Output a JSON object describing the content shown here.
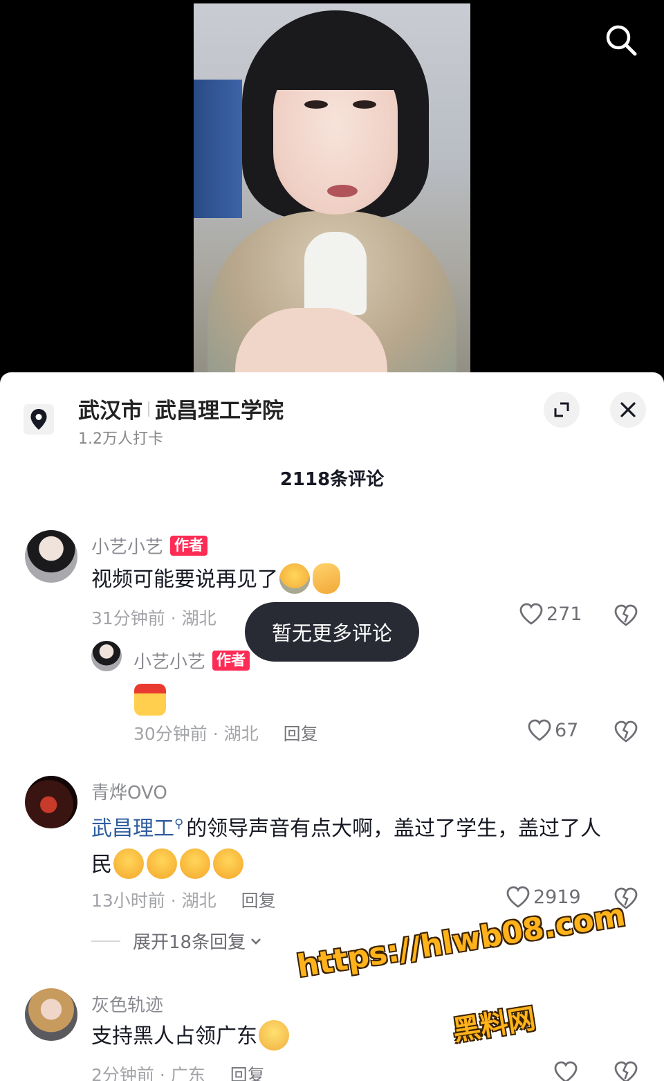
{
  "icons": {
    "search": "search-icon",
    "location": "location-pin-icon",
    "expand": "expand-icon",
    "close": "close-icon",
    "like": "heart-outline-icon",
    "dislike": "broken-heart-icon",
    "chevron": "chevron-down-icon"
  },
  "colors": {
    "author_tag": "#fe2c55",
    "topic_link": "#2f5d9f",
    "watermark": "#ffb21a"
  },
  "location": {
    "city": "武汉市",
    "place": "武昌理工学院",
    "checkins": "1.2万人打卡"
  },
  "comments_header": {
    "title": "2118条评论"
  },
  "comments": [
    {
      "user": "小艺小艺",
      "tag": "作者",
      "text": "视频可能要说再见了",
      "emojis": [
        "cry",
        "wave"
      ],
      "meta": "31分钟前 · 湖北",
      "likes": "271",
      "replies": [
        {
          "user": "小艺小艺",
          "tag": "作者",
          "meta": "30分钟前 · 湖北",
          "reply_label": "回复",
          "likes": "67"
        }
      ]
    },
    {
      "user": "青烨OVO",
      "topic": "武昌理工",
      "text": "的领导声音有点大啊，盖过了学生，盖过了人",
      "text_line2": "民",
      "emojis": [
        "smile",
        "smile",
        "smile",
        "wink"
      ],
      "meta": "13小时前 · 湖北",
      "reply_label": "回复",
      "likes": "2919",
      "expand_label": "展开18条回复"
    },
    {
      "user": "灰色轨迹",
      "text": "支持黑人占领广东",
      "emojis": [
        "silly"
      ],
      "meta": "2分钟前 · 广东",
      "reply_label": "回复"
    }
  ],
  "toast": "暂无更多评论",
  "watermark": {
    "url": "https://hlwb08.com",
    "name": "黑料网"
  }
}
